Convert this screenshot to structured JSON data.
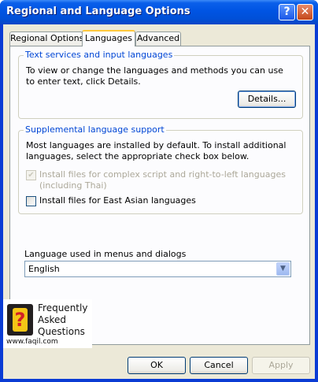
{
  "window": {
    "title": "Regional and Language Options"
  },
  "titlebar_buttons": {
    "help": "?",
    "close": "✕"
  },
  "tabs": [
    {
      "label": "Regional Options"
    },
    {
      "label": "Languages"
    },
    {
      "label": "Advanced"
    }
  ],
  "text_services": {
    "legend": "Text services and input languages",
    "description": "To view or change the languages and methods you can use to enter text, click Details.",
    "details_button": "Details..."
  },
  "supplemental": {
    "legend": "Supplemental language support",
    "description": "Most languages are installed by default. To install additional languages, select the appropriate check box below.",
    "complex_script": {
      "label": "Install files for complex script and right-to-left languages (including Thai)",
      "checked": true,
      "enabled": false
    },
    "east_asian": {
      "label": "Install files for East Asian languages",
      "checked": false,
      "enabled": true
    }
  },
  "menus_language": {
    "label": "Language used in menus and dialogs",
    "value": "English"
  },
  "faq_logo": {
    "line1": "Frequently",
    "line2": "Asked",
    "line3": "Questions",
    "url": "www.faqil.com"
  },
  "buttons": {
    "ok": "OK",
    "cancel": "Cancel",
    "apply": "Apply"
  }
}
